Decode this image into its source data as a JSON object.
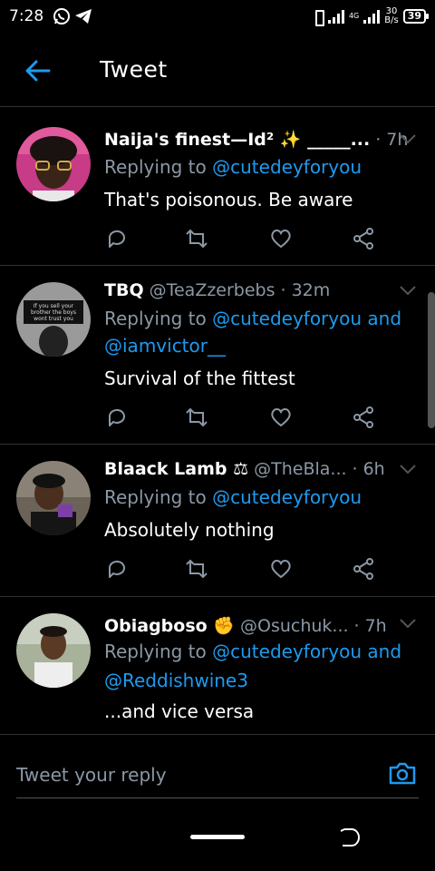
{
  "status_bar": {
    "time": "7:28",
    "net_speed_value": "30",
    "net_speed_unit": "B/s",
    "battery": "39",
    "network_label": "4G"
  },
  "header": {
    "title": "Tweet"
  },
  "tweets": [
    {
      "name": "Naija's finest—Id² ✨ _____...",
      "handle": "",
      "time": "7h",
      "replying_prefix": "Replying to",
      "mentions": "@cutedeyforyou",
      "mentions_line2": "",
      "text": "That's poisonous. Be aware"
    },
    {
      "name": "TBQ",
      "handle": "@TeaZzerbebs",
      "time": "32m",
      "replying_prefix": "Replying to",
      "mentions": "@cutedeyforyou and",
      "mentions_line2": "@iamvictor__",
      "text": "Survival of the fittest",
      "avatar_text": "If you sell your brother the boys wont trust you"
    },
    {
      "name": "Blaack Lamb ⚖",
      "handle": "@TheBla...",
      "time": "6h",
      "replying_prefix": "Replying to",
      "mentions": "@cutedeyforyou",
      "mentions_line2": "",
      "text": "Absolutely nothing"
    },
    {
      "name": "Obiagboso ✊",
      "handle": "@Osuchuk...",
      "time": "7h",
      "replying_prefix": "Replying to",
      "mentions": "@cutedeyforyou and",
      "mentions_line2": "@Reddishwine3",
      "text": "...and vice versa"
    }
  ],
  "reply_box": {
    "placeholder": "Tweet your reply"
  },
  "icons": {
    "back": "arrow-left-icon",
    "reply": "comment-icon",
    "retweet": "retweet-icon",
    "like": "heart-icon",
    "share": "share-icon",
    "camera": "camera-icon",
    "more": "chevron-down-icon"
  },
  "colors": {
    "background": "#000000",
    "accent": "#1d9bf0",
    "secondary_text": "#8b98a5",
    "divider": "#2f3336"
  }
}
